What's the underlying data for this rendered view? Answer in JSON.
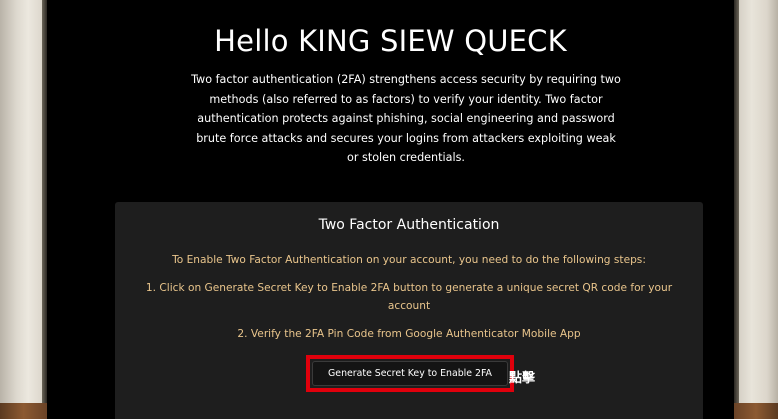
{
  "header": {
    "greeting": "Hello KING SIEW QUECK",
    "intro": "Two factor authentication (2FA) strengthens access security by requiring two methods (also referred to as factors) to verify your identity. Two factor authentication protects against phishing, social engineering and password brute force attacks and secures your logins from attackers exploiting weak or stolen credentials."
  },
  "card": {
    "title": "Two Factor Authentication",
    "steps_intro": "To Enable Two Factor Authentication on your account, you need to do the following steps:",
    "step1": "1. Click on Generate Secret Key to Enable 2FA button to generate a unique secret QR code for your account",
    "step2": "2. Verify the 2FA Pin Code from Google Authenticator Mobile App",
    "generate_button": "Generate Secret Key to Enable 2FA"
  },
  "annotation": {
    "click_label": "點擊",
    "highlight_color": "#e0000c"
  },
  "colors": {
    "background": "#000000",
    "card": "#1e1e1e",
    "step_text": "#e9c58c"
  }
}
